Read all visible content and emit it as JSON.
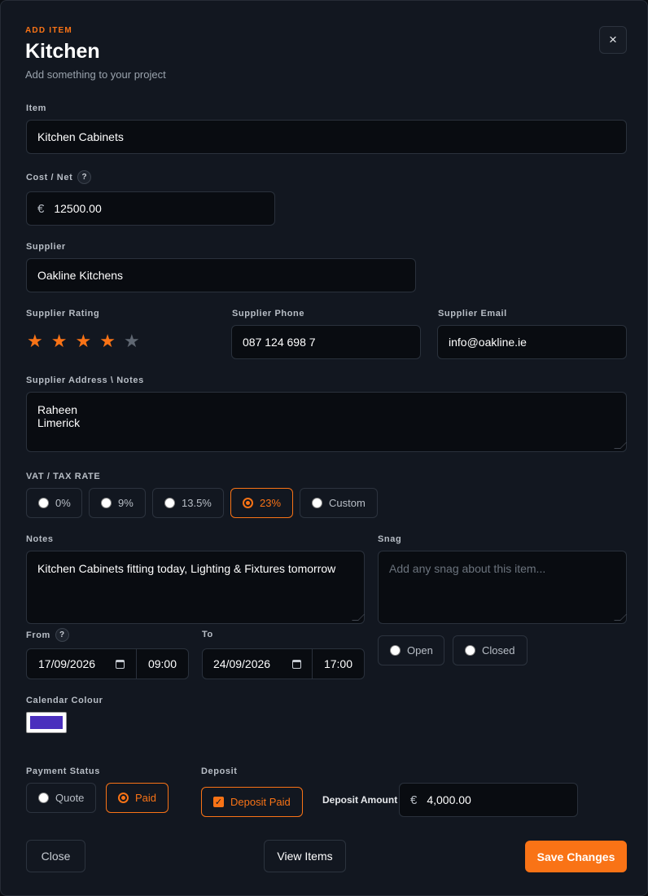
{
  "header": {
    "eyebrow": "ADD ITEM",
    "title": "Kitchen",
    "subtitle": "Add something to your project",
    "close_icon": "×"
  },
  "item": {
    "label": "Item",
    "value": "Kitchen Cabinets"
  },
  "cost": {
    "label": "Cost / Net",
    "help": "?",
    "currency": "€",
    "value": "12500.00"
  },
  "supplier": {
    "label": "Supplier",
    "value": "Oakline Kitchens"
  },
  "rating": {
    "label": "Supplier Rating",
    "value": 4,
    "max": 5,
    "filled_color": "#f97316",
    "empty_color": "#5f6772"
  },
  "phone": {
    "label": "Supplier Phone",
    "value": "087 124 698 7"
  },
  "email": {
    "label": "Supplier Email",
    "value": "info@oakline.ie"
  },
  "address": {
    "label": "Supplier Address \\ Notes",
    "value": "Raheen\nLimerick"
  },
  "vat": {
    "label": "VAT / TAX RATE",
    "options": [
      "0%",
      "9%",
      "13.5%",
      "23%",
      "Custom"
    ],
    "selected": "23%"
  },
  "notes": {
    "label": "Notes",
    "value": "Kitchen Cabinets fitting today, Lighting & Fixtures tomorrow"
  },
  "snag": {
    "label": "Snag",
    "placeholder": "Add any snag about this item...",
    "options": [
      "Open",
      "Closed"
    ]
  },
  "from": {
    "label": "From",
    "help": "?",
    "date": "17/09/2026",
    "time": "09:00"
  },
  "to": {
    "label": "To",
    "date": "24/09/2026",
    "time": "17:00"
  },
  "calendar": {
    "label": "Calendar Colour",
    "color": "#4a2fbd"
  },
  "payment": {
    "label": "Payment Status",
    "options": [
      "Quote",
      "Paid"
    ],
    "selected": "Paid"
  },
  "deposit": {
    "label": "Deposit",
    "checkbox_label": "Deposit Paid",
    "checked": true,
    "amount_label": "Deposit Amount",
    "currency": "€",
    "amount": "4,000.00"
  },
  "footer": {
    "close_label": "Close",
    "view_label": "View Items",
    "save_label": "Save Changes"
  },
  "colors": {
    "accent": "#f97316",
    "background": "#121720",
    "field": "#090c11"
  }
}
